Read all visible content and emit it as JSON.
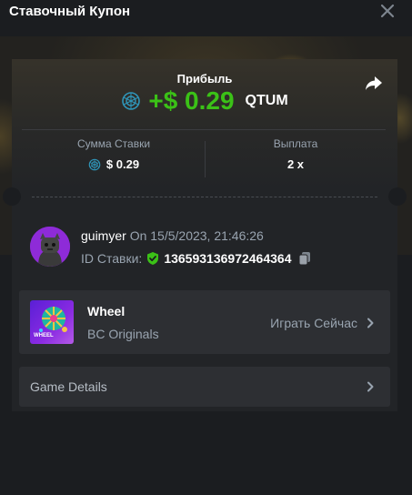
{
  "header": {
    "title": "Ставочный Купон"
  },
  "profit": {
    "label": "Прибыль",
    "amount": "+$ 0.29",
    "currency": "QTUM"
  },
  "stats": {
    "bet_amount_label": "Сумма Ставки",
    "bet_amount_value": "$ 0.29",
    "payout_label": "Выплата",
    "payout_value": "2 x"
  },
  "bet": {
    "username": "guimyer",
    "date_prefix": "On",
    "datetime": "15/5/2023, 21:46:26",
    "id_label": "ID Ставки:",
    "id_value": "136593136972464364"
  },
  "game": {
    "thumb_label": "WHEEL",
    "name": "Wheel",
    "provider": "BC Originals",
    "play_label": "Играть Сейчас"
  },
  "details": {
    "label": "Game Details"
  },
  "icons": {
    "close": "close-icon",
    "share": "share-icon",
    "coin": "qtum-coin-icon",
    "shield": "shield-check-icon",
    "copy": "copy-icon",
    "chevron": "chevron-right-icon"
  },
  "colors": {
    "accent_green": "#3bc117",
    "muted_text": "#99a4b0",
    "panel": "#222427",
    "card": "#2d2f33",
    "background": "#1b1d20"
  }
}
